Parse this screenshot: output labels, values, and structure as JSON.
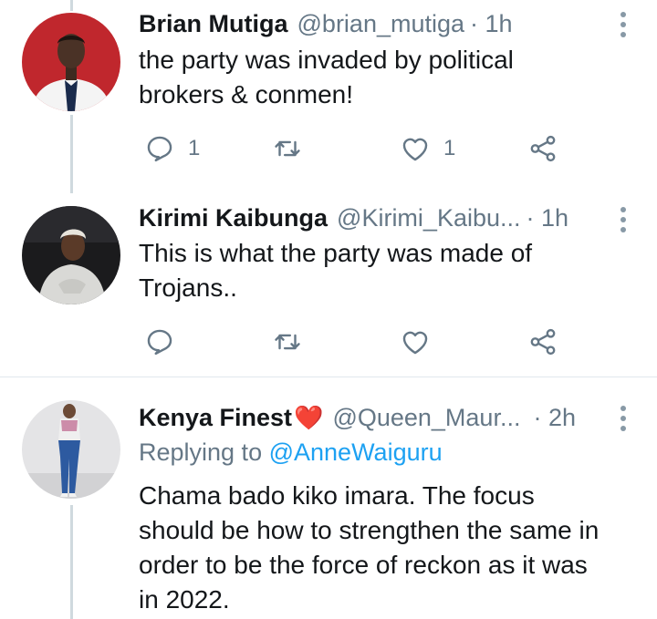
{
  "colors": {
    "accent": "#1da1f2",
    "muted": "#657786",
    "heart": "#e0245e"
  },
  "tweets": [
    {
      "name": "Brian Mutiga",
      "handle": "@brian_mutiga",
      "time": "· 1h",
      "lines": [
        "the party was invaded by political",
        "brokers & conmen!"
      ],
      "reply_count": "1",
      "retweet_count": "",
      "like_count": "1"
    },
    {
      "name": "Kirimi Kaibunga",
      "handle": "@Kirimi_Kaibu...",
      "time": "· 1h",
      "lines": [
        "This is what the party was made of",
        "Trojans.."
      ],
      "reply_count": "",
      "retweet_count": "",
      "like_count": ""
    },
    {
      "name": "Kenya Finest",
      "name_emoji": "❤️",
      "handle": "@Queen_Maur...",
      "time": "· 2h",
      "replying_prefix": "Replying to",
      "replying_to": "@AnneWaiguru",
      "lines": [
        "Chama bado kiko imara. The focus",
        "should be how to strengthen the same in",
        "order to be the force of reckon as it was",
        "in 2022."
      ]
    }
  ]
}
